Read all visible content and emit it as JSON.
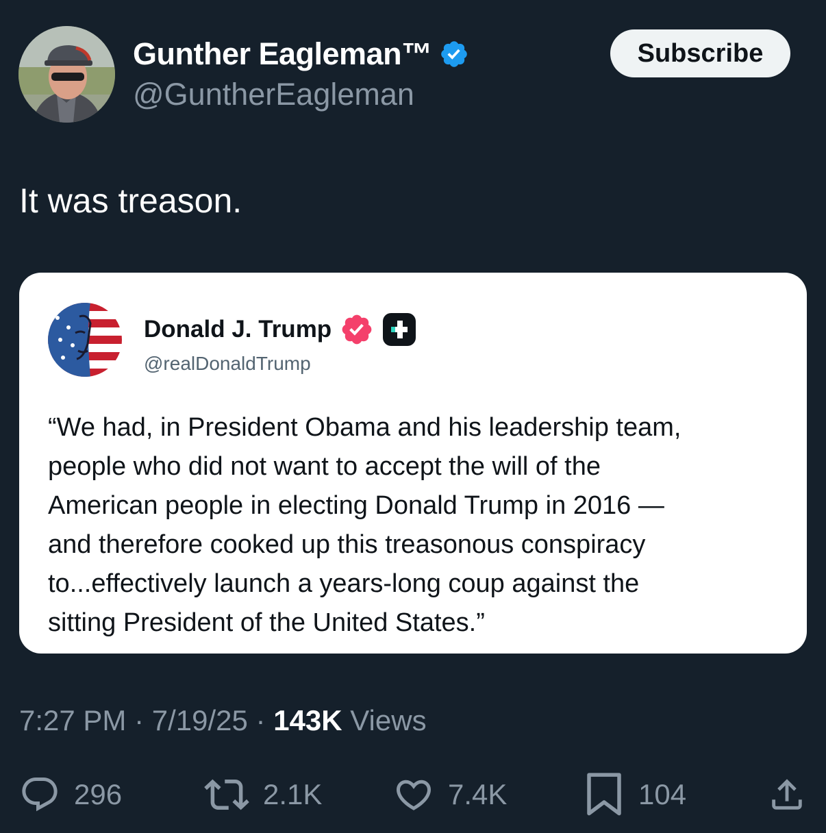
{
  "author": {
    "display_name": "Gunther Eagleman™",
    "handle": "@GuntherEagleman",
    "verified": true
  },
  "subscribe_label": "Subscribe",
  "tweet_text": "It was treason.",
  "quoted_card": {
    "name": "Donald J. Trump",
    "handle": "@realDonaldTrump",
    "quote_lines": [
      "“We had, in President Obama and his leadership team,",
      "people who did not want to accept the will of the",
      "American people in electing Donald Trump in 2016 —",
      "and therefore cooked up this treasonous conspiracy",
      "to...effectively launch a years-long coup against the",
      "sitting President of the United States.”"
    ]
  },
  "meta": {
    "time": "7:27 PM",
    "separator": " · ",
    "date": "7/19/25",
    "views_count": "143K",
    "views_label": " Views"
  },
  "actions": {
    "replies": "296",
    "reposts": "2.1K",
    "likes": "7.4K",
    "bookmarks": "104"
  },
  "icons": {
    "verified": "verified-badge-icon",
    "card_verified": "verified-badge-icon",
    "card_app": "plus-app-icon",
    "reply": "reply-icon",
    "repost": "repost-icon",
    "like": "heart-icon",
    "bookmark": "bookmark-icon",
    "share": "share-icon"
  },
  "colors": {
    "background": "#15202b",
    "verified_blue": "#1d9bf0",
    "card_verified_pink": "#f4406b",
    "muted_text": "#8b98a5"
  }
}
